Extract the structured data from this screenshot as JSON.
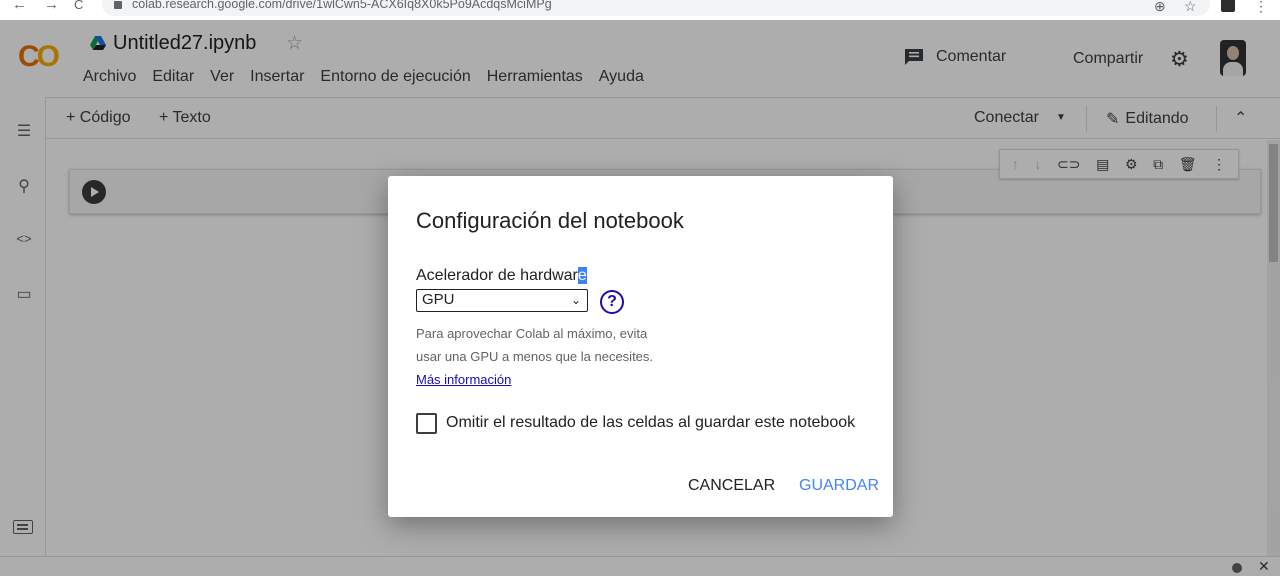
{
  "browser": {
    "back": "←",
    "forward": "→",
    "reload": "C",
    "url": "colab.research.google.com/drive/1wlCwn5-ACX6Iq8X0k5Po9AcdqsMciMPg",
    "zoom_icon": "⊕",
    "bookmark_icon": "☆",
    "menu_icon": "⋮"
  },
  "header": {
    "logo_left": "C",
    "logo_right": "O",
    "notebook_title": "Untitled27.ipynb",
    "star_icon": "☆",
    "menus": [
      "Archivo",
      "Editar",
      "Ver",
      "Insertar",
      "Entorno de ejecución",
      "Herramientas",
      "Ayuda"
    ],
    "comment_label": "Comentar",
    "share_label": "Compartir",
    "gear_icon": "⚙"
  },
  "toolbar": {
    "add_code": "+ Código",
    "add_text": "+ Texto",
    "connect_label": "Conectar",
    "connect_caret": "▼",
    "edit_label": "Editando",
    "pencil_icon": "✎",
    "collapse_icon": "⌃"
  },
  "sidebar": {
    "toc_icon": "☰",
    "search_icon": "⚲",
    "code_icon": "<>",
    "folder_icon": "▭"
  },
  "cell_toolbar": {
    "up": "↑",
    "down": "↓",
    "link": "⊂⊃",
    "comment": "▤",
    "settings": "⚙",
    "mirror": "⧉",
    "delete": "🗑",
    "more": "⋮"
  },
  "dialog": {
    "title": "Configuración del notebook",
    "accelerator_label_main": "Acelerador de hardwar",
    "accelerator_label_selected": "e",
    "accelerator_value": "GPU",
    "select_caret": "⌄",
    "help_icon": "?",
    "hint_line1": "Para aprovechar Colab al máximo, evita",
    "hint_line2": "usar una GPU a menos que la necesites.",
    "more_info": "Más información",
    "omit_output_label": "Omitir el resultado de las celdas al guardar este notebook",
    "omit_output_checked": false,
    "cancel_label": "CANCELAR",
    "save_label": "GUARDAR"
  },
  "footer": {
    "close_icon": "✕"
  },
  "colors": {
    "accent_blue": "#4285f4",
    "link_blue": "#1a0dab",
    "logo_yellow": "#f9ab00",
    "logo_orange": "#e8710a"
  }
}
